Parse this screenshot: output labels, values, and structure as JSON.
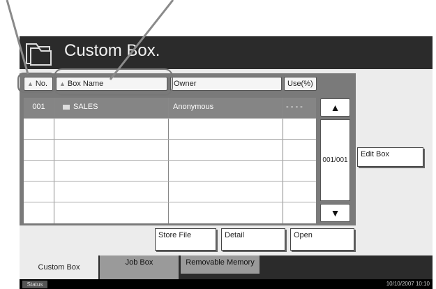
{
  "title": "Custom Box.",
  "columns": {
    "no": "No.",
    "box_name": "Box Name",
    "owner": "Owner",
    "use": "Use(%)"
  },
  "rows": [
    {
      "no": "001",
      "name": "SALES",
      "owner": "Anonymous",
      "use": "- - - -"
    }
  ],
  "page_indicator": "001/001",
  "buttons": {
    "edit_box": "Edit Box",
    "store_file": "Store File",
    "detail": "Detail",
    "open": "Open"
  },
  "tabs": [
    "Custom Box",
    "Job Box",
    "Removable Memory"
  ],
  "status": {
    "label": "Status",
    "datetime": "10/10/2007  10:10"
  },
  "colors": {
    "titlebar": "#2b2b2b",
    "selected_row": "#858585",
    "panel": "#ececec"
  },
  "icons": {
    "title": "custom-box-folder-icon",
    "sort": "sort-triangle-icon",
    "row": "folder-icon",
    "scroll_up": "up-arrow-icon",
    "scroll_down": "down-arrow-icon"
  }
}
